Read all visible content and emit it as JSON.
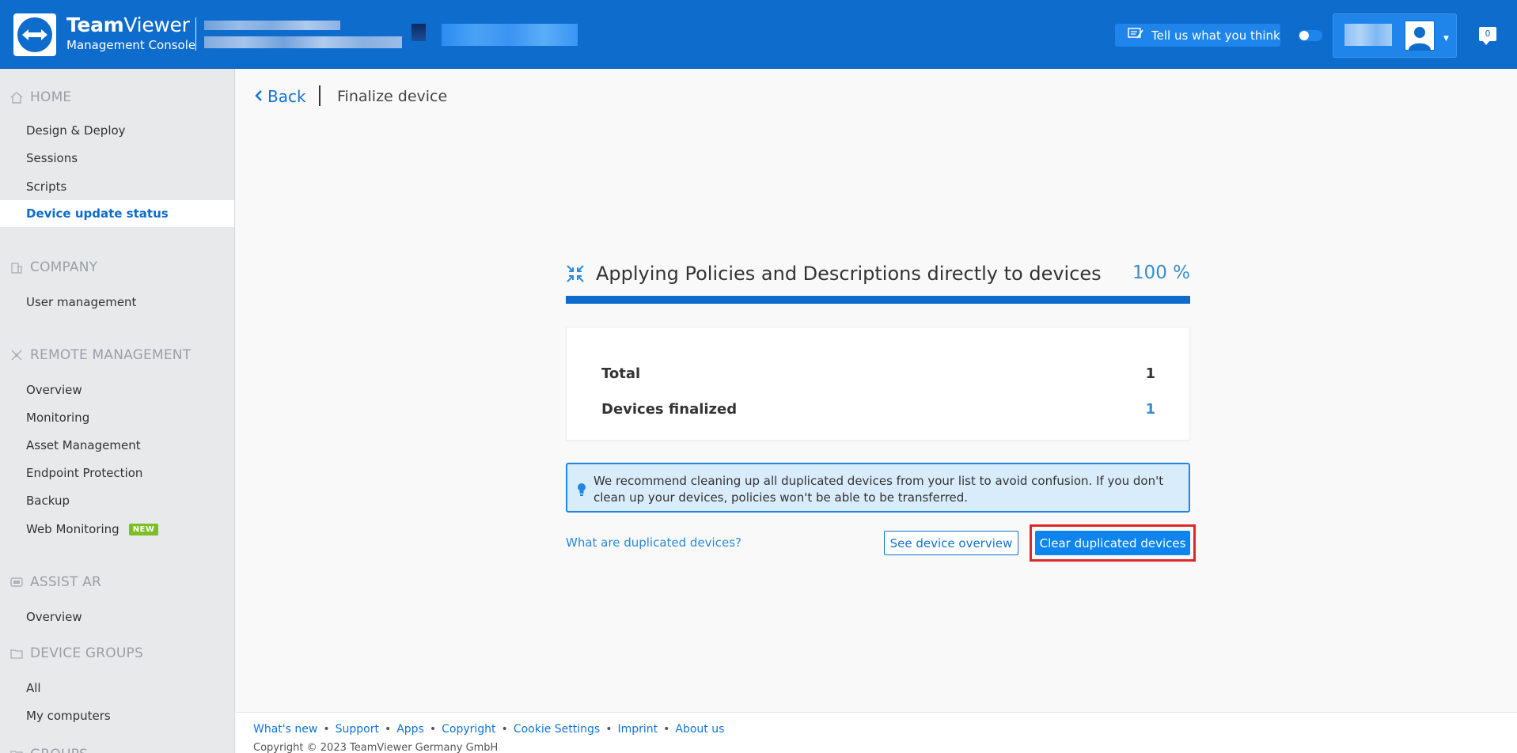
{
  "header": {
    "brand_bold": "Team",
    "brand_rest": "Viewer",
    "brand_subtitle": "Management Console",
    "feedback_label": "Tell us what you think",
    "notification_count": "0",
    "colors": {
      "header_bg": "#0e6ccd",
      "accent": "#1f85ea"
    }
  },
  "sidebar": {
    "sections": {
      "home": "HOME",
      "company": "COMPANY",
      "remote": "REMOTE MANAGEMENT",
      "assist": "ASSIST AR",
      "groups": "DEVICE GROUPS",
      "groups2": "GROUPS"
    },
    "items": {
      "design": "Design & Deploy",
      "sessions": "Sessions",
      "scripts": "Scripts",
      "device_update": "Device update status",
      "user_mgmt": "User management",
      "overview": "Overview",
      "monitoring": "Monitoring",
      "asset": "Asset Management",
      "endpoint": "Endpoint Protection",
      "backup": "Backup",
      "web_monitoring": "Web Monitoring",
      "assist_overview": "Overview",
      "all": "All",
      "my_computers": "My computers"
    },
    "new_badge": "NEW"
  },
  "main": {
    "back_label": "Back",
    "page_title": "Finalize device",
    "progress": {
      "title": "Applying Policies and Descriptions directly to devices",
      "percent_label": "100 %",
      "fraction": 1.0
    },
    "stats": {
      "total_label": "Total",
      "total_value": "1",
      "finalized_label": "Devices finalized",
      "finalized_value": "1"
    },
    "info_text": "We recommend cleaning up all duplicated devices from your list to avoid confusion. If you don't clean up your devices, policies won't be able to be transferred.",
    "link_duplicated": "What are duplicated devices?",
    "btn_overview": "See device overview",
    "btn_clear": "Clear duplicated devices"
  },
  "footer": {
    "links": [
      "What's new",
      "Support",
      "Apps",
      "Copyright",
      "Cookie Settings",
      "Imprint",
      "About us"
    ],
    "copyright": "Copyright © 2023 TeamViewer Germany GmbH"
  }
}
